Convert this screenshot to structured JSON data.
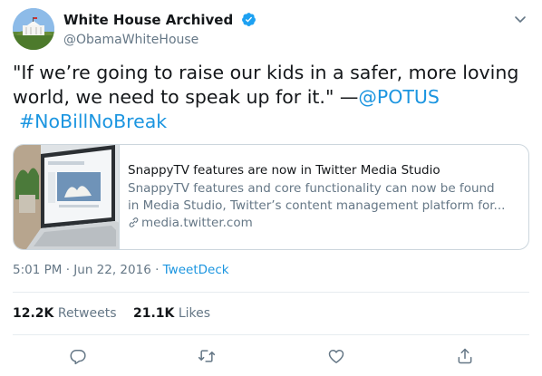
{
  "header": {
    "display_name": "White House Archived",
    "handle": "@ObamaWhiteHouse",
    "verified_icon": "verified-badge-icon",
    "menu_icon": "chevron-down-icon"
  },
  "tweet": {
    "text_part1": "\"If we’re going to raise our kids in a safer, more loving world, we need to speak up for it.\" —",
    "mention": "@POTUS",
    "hashtag": "#NoBillNoBreak"
  },
  "card": {
    "title": "SnappyTV features are now in Twitter Media Studio",
    "desc_line1": "SnappyTV features and core functionality can now be found",
    "desc_line2": "in Media Studio, Twitter’s content management platform for...",
    "domain": "media.twitter.com"
  },
  "meta": {
    "time": "5:01 PM",
    "separator1": " · ",
    "date": "Jun 22, 2016",
    "separator2": " · ",
    "source": "TweetDeck"
  },
  "stats": {
    "retweets_count": "12.2K",
    "retweets_label": "Retweets",
    "likes_count": "21.1K",
    "likes_label": "Likes"
  },
  "actions": [
    "reply-icon",
    "retweet-icon",
    "like-icon",
    "share-icon"
  ],
  "colors": {
    "link": "#1b95e0",
    "secondary_text": "#657786",
    "border": "#ccd6dd",
    "verified": "#1da1f2"
  }
}
